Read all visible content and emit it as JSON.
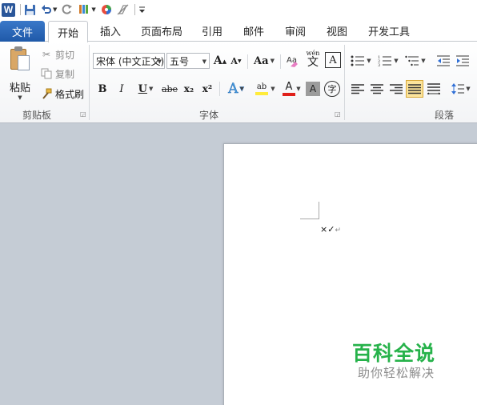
{
  "qat": {
    "app_icon_letter": "W",
    "icons": [
      "save-icon",
      "undo-icon",
      "redo-icon",
      "format-painter-icon",
      "color-icon",
      "clear-format-icon",
      "customize-icon"
    ]
  },
  "tabs": [
    {
      "label": "文件"
    },
    {
      "label": "开始"
    },
    {
      "label": "插入"
    },
    {
      "label": "页面布局"
    },
    {
      "label": "引用"
    },
    {
      "label": "邮件"
    },
    {
      "label": "审阅"
    },
    {
      "label": "视图"
    },
    {
      "label": "开发工具"
    }
  ],
  "clipboard": {
    "paste_label": "粘贴",
    "cut_label": "剪切",
    "copy_label": "复制",
    "format_painter_label": "格式刷",
    "group_label": "剪贴板"
  },
  "font": {
    "font_name": "宋体 (中文正文)",
    "font_size": "五号",
    "group_label": "字体",
    "grow_label": "A",
    "shrink_label": "A",
    "change_case_label": "Aa",
    "clear_label": "A",
    "phonetic_label": "wén",
    "phonetic_char": "文",
    "border_label": "A",
    "bold_label": "B",
    "italic_label": "I",
    "underline_label": "U",
    "strike_label": "abe",
    "subscript_label": "x₂",
    "superscript_label": "x²",
    "effects_label": "A",
    "highlight_label": "ab",
    "font_color_label": "A",
    "shading_label": "A",
    "enclose_label": "字"
  },
  "paragraph": {
    "group_label": "段落"
  },
  "document": {
    "typed_text": "×✓",
    "paragraph_mark": "↵"
  },
  "watermark": {
    "title": "百科全说",
    "subtitle": "助你轻松解决"
  },
  "colors": {
    "file_tab": "#2a64b3",
    "accent_green": "#26b24a",
    "highlight_yellow": "#fce49b",
    "font_red": "#e0201b"
  }
}
